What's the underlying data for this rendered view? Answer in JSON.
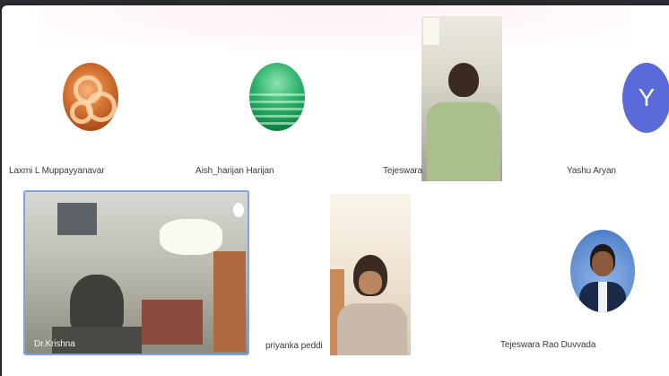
{
  "participants": [
    {
      "name": "Laxmi L Muppayyanavar",
      "kind": "avatar-image",
      "icon": "om-symbol-avatar"
    },
    {
      "name": "Aish_harijan Harijan",
      "kind": "avatar-image",
      "icon": "green-landscape-avatar"
    },
    {
      "name": "Tejeswara",
      "kind": "video"
    },
    {
      "name": "Yashu Aryan",
      "kind": "letter-avatar",
      "initial": "Y",
      "color": "#5a6ad8"
    },
    {
      "name": "Dr.Krishna",
      "kind": "video",
      "active_speaker": true
    },
    {
      "name": "priyanka peddi",
      "kind": "video"
    },
    {
      "name": "Tejeswara Rao Duvvada",
      "kind": "avatar-image",
      "icon": "profile-photo-avatar"
    }
  ],
  "colors": {
    "active_speaker_border": "#7ea4e6",
    "background": "#ffffff",
    "outer": "#2a2d31"
  }
}
